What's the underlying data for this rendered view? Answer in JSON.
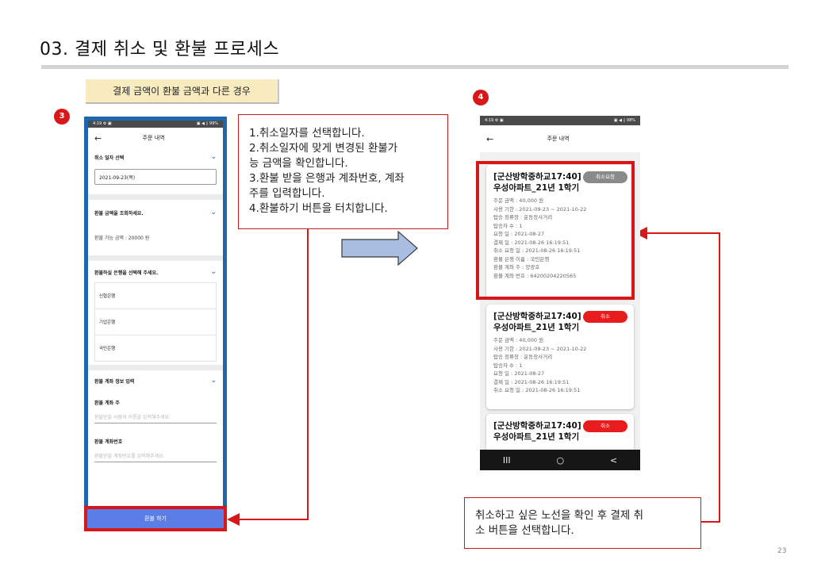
{
  "title": "03. 결제 취소 및 환불 프로세스",
  "condition_tag": "결제 금액이 환불 금액과 다른 경우",
  "badges": {
    "left": "3",
    "right": "4"
  },
  "left_phone": {
    "status_left": "4:19 ⚙ ▣",
    "status_right": "▣ ◀ ▯ 99%",
    "header_title": "주문 내역",
    "sections": {
      "cancel_date_label": "취소 일자 선택",
      "cancel_date_value": "2021-09-23(목)",
      "refund_amount_label": "환불 금액을 조회하세요.",
      "refund_amount_value": "환불 가능 금액 : 20000 원",
      "bank_label": "환불하실 은행을 선택해 주세요.",
      "banks": [
        "신협은행",
        "기업은행",
        "국민은행"
      ],
      "account_info_label": "환불 계좌 정보 입력",
      "holder_label": "환불 계좌 주",
      "holder_placeholder": "환불받을 사람의 이름을 입력해주세요.",
      "account_no_label": "환불 계좌번호",
      "account_no_placeholder": "환불받을 계좌번호를 입력해주세요."
    },
    "refund_button": "환불 하기"
  },
  "instructions": [
    "1.취소일자를 선택합니다.",
    "2.취소일자에 맞게 변경된 환불가",
    "능 금액을 확인합니다.",
    "3.환불 받을 은행과 계좌번호, 계좌",
    "주를 입력합니다.",
    "4.환불하기 버튼을 터치합니다."
  ],
  "right_phone": {
    "status_left": "4:19 ⚙ ▣",
    "status_right": "▣ ◀ ▯ 98%",
    "header_title": "주문 내역",
    "cards": [
      {
        "title_line1": "[군산방학중하교17:40]",
        "title_line2": "우성아파트_21년 1학기",
        "badge": "취소요청",
        "badge_color": "#8a8a8a",
        "details": [
          "주문 금액 : 40,000 원",
          "사용 기한 : 2021-09-23 ~ 2021-10-22",
          "탑승 정류장 : 운동장사거리",
          "탑승자 수 : 1",
          "요청 일 : 2021-08-27",
          "결제 일 : 2021-08-26 16:19:51",
          "취소 요청 일 : 2021-08-26 16:19:51",
          "환불 은행 이름 : 국민은행",
          "환불 계좌 주 : 양광호",
          "환불 계좌 번호 : 64200204220565"
        ]
      },
      {
        "title_line1": "[군산방학중하교17:40]",
        "title_line2": "우성아파트_21년 1학기",
        "badge": "취소",
        "badge_color": "#e81c1c",
        "details": [
          "주문 금액 : 40,000 원",
          "사용 기한 : 2021-09-23 ~ 2021-10-22",
          "탑승 정류장 : 운동장사거리",
          "탑승자 수 : 1",
          "요청 일 : 2021-08-27",
          "결제 일 : 2021-08-26 16:19:51",
          "취소 요청 일 : 2021-08-26 16:19:51"
        ]
      },
      {
        "title_line1": "[군산방학중하교17:40]",
        "title_line2": "우성아파트_21년 1학기",
        "badge": "취소",
        "badge_color": "#e81c1c",
        "details": []
      }
    ],
    "nav": [
      "III",
      "○",
      "<"
    ]
  },
  "note": [
    "취소하고 싶은 노선을 확인 후 결제 취",
    "소 버튼을 선택합니다."
  ],
  "page_number": "23",
  "colors": {
    "accent_red": "#d81818",
    "frame_blue": "#1e67ad",
    "button_blue": "#5a7de6",
    "tag_yellow": "#f8ebc0",
    "arrow_fill": "#a8bde0"
  }
}
